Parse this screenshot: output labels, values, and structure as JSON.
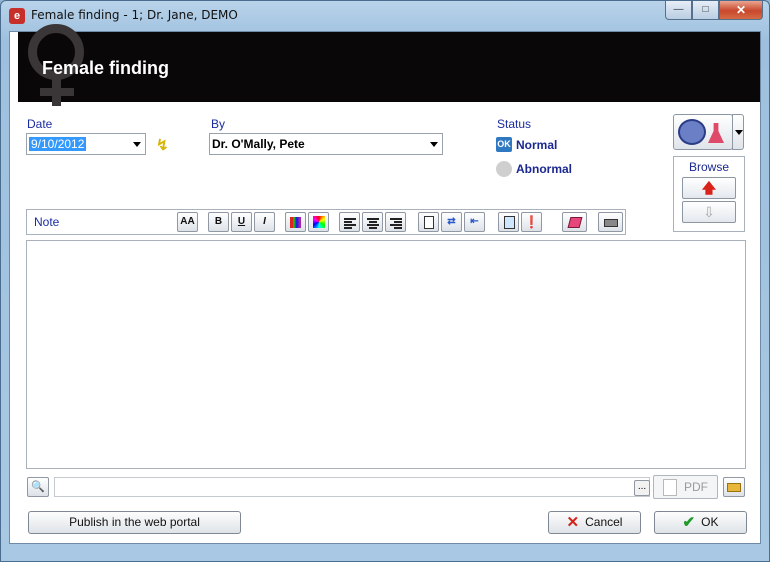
{
  "window": {
    "title": "Female finding - 1; Dr. Jane, DEMO",
    "app_icon": "e",
    "controls": {
      "minimize": "minimize-icon",
      "maximize": "maximize-icon",
      "close": "close-icon"
    }
  },
  "header": {
    "title": "Female finding",
    "watermark_icon": "venus-symbol-icon"
  },
  "date": {
    "label": "Date",
    "value": "9/10/2012"
  },
  "by": {
    "label": "By",
    "value": "Dr. O'Mally, Pete"
  },
  "status": {
    "label": "Status",
    "options": [
      {
        "label": "Normal",
        "selected": true,
        "badge": "OK"
      },
      {
        "label": "Abnormal",
        "selected": false
      }
    ]
  },
  "browse": {
    "label": "Browse"
  },
  "note": {
    "label": "Note",
    "toolbar": [
      {
        "name": "font-button",
        "text": "AA"
      },
      {
        "name": "bold-button",
        "text": "B"
      },
      {
        "name": "underline-button",
        "text": "U"
      },
      {
        "name": "italic-button",
        "text": "I"
      },
      {
        "name": "text-color-button",
        "text": ""
      },
      {
        "name": "highlight-color-button",
        "text": ""
      },
      {
        "name": "align-left-button",
        "text": ""
      },
      {
        "name": "align-center-button",
        "text": ""
      },
      {
        "name": "align-right-button",
        "text": ""
      },
      {
        "name": "new-document-button",
        "text": ""
      },
      {
        "name": "insert-link-button",
        "text": ""
      },
      {
        "name": "insert-field-button",
        "text": ""
      },
      {
        "name": "clipboard-button",
        "text": ""
      },
      {
        "name": "spell-check-button",
        "text": ""
      },
      {
        "name": "eraser-button",
        "text": ""
      },
      {
        "name": "print-button",
        "text": ""
      }
    ],
    "body": ""
  },
  "attachment": {
    "value": "",
    "ellipsis": "...",
    "pdf_label": "PDF"
  },
  "footer": {
    "publish_label": "Publish in the web portal",
    "cancel_label": "Cancel",
    "ok_label": "OK"
  },
  "colors": {
    "header_bg": "#0a0708",
    "label_blue": "#1a2ca0",
    "ok_badge": "#2f79c2",
    "cancel_red": "#d2231b",
    "ok_green": "#1f9a2c"
  }
}
